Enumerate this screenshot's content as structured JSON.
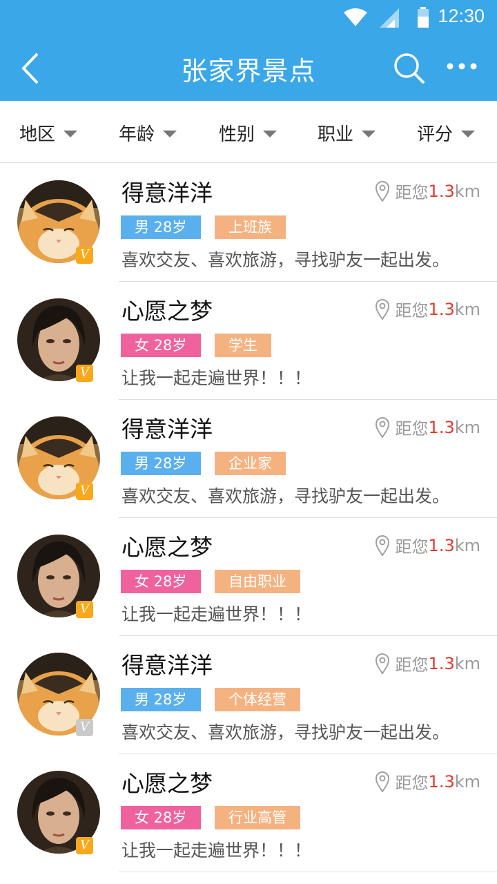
{
  "status": {
    "time": "12:30"
  },
  "header": {
    "title": "张家界景点",
    "back_icon": "chevron-left-icon",
    "search_icon": "search-icon",
    "more_icon": "more-dots-icon"
  },
  "filters": [
    {
      "label": "地区"
    },
    {
      "label": "年龄"
    },
    {
      "label": "性别"
    },
    {
      "label": "职业"
    },
    {
      "label": "评分"
    }
  ],
  "distance": {
    "prefix": "距您",
    "value": "1.3",
    "unit": "km"
  },
  "users": [
    {
      "name": "得意洋洋",
      "gender_tag": "男 28岁",
      "gender": "male",
      "job": "上班族",
      "bio": "喜欢交友、喜欢旅游，寻找驴友一起出发。",
      "avatar": "cat",
      "verified": true,
      "badge": "V"
    },
    {
      "name": "心愿之梦",
      "gender_tag": "女 28岁",
      "gender": "female",
      "job": "学生",
      "bio": "让我一起走遍世界！！！",
      "avatar": "woman",
      "verified": true,
      "badge": "V"
    },
    {
      "name": "得意洋洋",
      "gender_tag": "男 28岁",
      "gender": "male",
      "job": "企业家",
      "bio": "喜欢交友、喜欢旅游，寻找驴友一起出发。",
      "avatar": "cat",
      "verified": true,
      "badge": "V"
    },
    {
      "name": "心愿之梦",
      "gender_tag": "女 28岁",
      "gender": "female",
      "job": "自由职业",
      "bio": "让我一起走遍世界！！！",
      "avatar": "woman",
      "verified": true,
      "badge": "V"
    },
    {
      "name": "得意洋洋",
      "gender_tag": "男 28岁",
      "gender": "male",
      "job": "个体经营",
      "bio": "喜欢交友、喜欢旅游，寻找驴友一起出发。",
      "avatar": "cat",
      "verified": false,
      "badge": "V"
    },
    {
      "name": "心愿之梦",
      "gender_tag": "女 28岁",
      "gender": "female",
      "job": "行业高管",
      "bio": "让我一起走遍世界！！！",
      "avatar": "woman",
      "verified": true,
      "badge": "V"
    }
  ],
  "colors": {
    "header": "#39a7e8",
    "male_tag": "#5ab0ee",
    "female_tag": "#f0629d",
    "job_tag": "#f5b281",
    "badge": "#f9a81b",
    "distance_value": "#e8382a"
  }
}
